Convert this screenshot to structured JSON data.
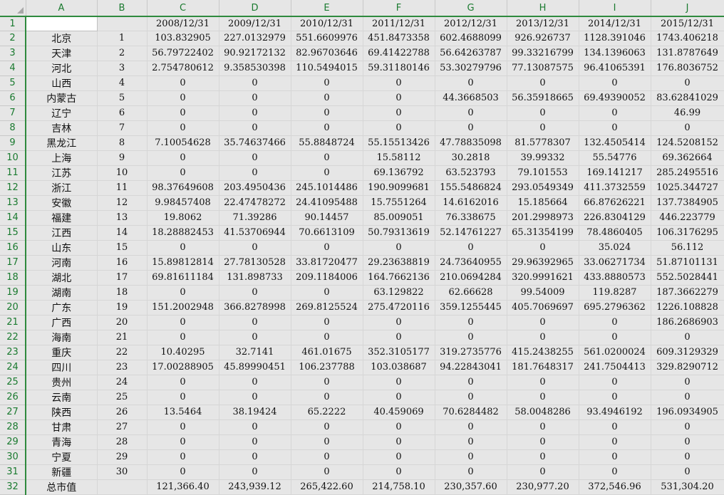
{
  "columns": [
    "A",
    "B",
    "C",
    "D",
    "E",
    "F",
    "G",
    "H",
    "I",
    "J"
  ],
  "header_row": [
    "",
    "",
    "2008/12/31",
    "2009/12/31",
    "2010/12/31",
    "2011/12/31",
    "2012/12/31",
    "2013/12/31",
    "2014/12/31",
    "2015/12/31"
  ],
  "rows": [
    [
      "北京",
      "1",
      "103.832905",
      "227.0132979",
      "551.6609976",
      "451.8473358",
      "602.4688099",
      "926.926737",
      "1128.391046",
      "1743.406218"
    ],
    [
      "天津",
      "2",
      "56.79722402",
      "90.92172132",
      "82.96703646",
      "69.41422788",
      "56.64263787",
      "99.33216799",
      "134.1396063",
      "131.8787649"
    ],
    [
      "河北",
      "3",
      "2.754780612",
      "9.358530398",
      "110.5494015",
      "59.31180146",
      "53.30279796",
      "77.13087575",
      "96.41065391",
      "176.8036752"
    ],
    [
      "山西",
      "4",
      "0",
      "0",
      "0",
      "0",
      "0",
      "0",
      "0",
      "0"
    ],
    [
      "内蒙古",
      "5",
      "0",
      "0",
      "0",
      "0",
      "44.3668503",
      "56.35918665",
      "69.49390052",
      "83.62841029"
    ],
    [
      "辽宁",
      "6",
      "0",
      "0",
      "0",
      "0",
      "0",
      "0",
      "0",
      "46.99"
    ],
    [
      "吉林",
      "7",
      "0",
      "0",
      "0",
      "0",
      "0",
      "0",
      "0",
      "0"
    ],
    [
      "黑龙江",
      "8",
      "7.10054628",
      "35.74637466",
      "55.8848724",
      "55.15513426",
      "47.78835098",
      "81.5778307",
      "132.4505414",
      "124.5208152"
    ],
    [
      "上海",
      "9",
      "0",
      "0",
      "0",
      "15.58112",
      "30.2818",
      "39.99332",
      "55.54776",
      "69.362664"
    ],
    [
      "江苏",
      "10",
      "0",
      "0",
      "0",
      "69.136792",
      "63.523793",
      "79.101553",
      "169.141217",
      "285.2495516"
    ],
    [
      "浙江",
      "11",
      "98.37649608",
      "203.4950436",
      "245.1014486",
      "190.9099681",
      "155.5486824",
      "293.0549349",
      "411.3732559",
      "1025.344727"
    ],
    [
      "安徽",
      "12",
      "9.98457408",
      "22.47478272",
      "24.41095488",
      "15.7551264",
      "14.6162016",
      "15.185664",
      "66.87626221",
      "137.7384905"
    ],
    [
      "福建",
      "13",
      "19.8062",
      "71.39286",
      "90.14457",
      "85.009051",
      "76.338675",
      "201.2998973",
      "226.8304129",
      "446.223779"
    ],
    [
      "江西",
      "14",
      "18.28882453",
      "41.53706944",
      "70.6613109",
      "50.79313619",
      "52.14761227",
      "65.31354199",
      "78.4860405",
      "106.3176295"
    ],
    [
      "山东",
      "15",
      "0",
      "0",
      "0",
      "0",
      "0",
      "0",
      "35.024",
      "56.112"
    ],
    [
      "河南",
      "16",
      "15.89812814",
      "27.78130528",
      "33.81720477",
      "29.23638819",
      "24.73640955",
      "29.96392965",
      "33.06271734",
      "51.87101131"
    ],
    [
      "湖北",
      "17",
      "69.81611184",
      "131.898733",
      "209.1184006",
      "164.7662136",
      "210.0694284",
      "320.9991621",
      "433.8880573",
      "552.5028441"
    ],
    [
      "湖南",
      "18",
      "0",
      "0",
      "0",
      "63.129822",
      "62.66628",
      "99.54009",
      "119.8287",
      "187.3662279"
    ],
    [
      "广东",
      "19",
      "151.2002948",
      "366.8278998",
      "269.8125524",
      "275.4720116",
      "359.1255445",
      "405.7069697",
      "695.2796362",
      "1226.108828"
    ],
    [
      "广西",
      "20",
      "0",
      "0",
      "0",
      "0",
      "0",
      "0",
      "0",
      "186.2686903"
    ],
    [
      "海南",
      "21",
      "0",
      "0",
      "0",
      "0",
      "0",
      "0",
      "0",
      "0"
    ],
    [
      "重庆",
      "22",
      "10.40295",
      "32.7141",
      "461.01675",
      "352.3105177",
      "319.2735776",
      "415.2438255",
      "561.0200024",
      "609.3129329"
    ],
    [
      "四川",
      "23",
      "17.00288905",
      "45.89990451",
      "106.237788",
      "103.038687",
      "94.22843041",
      "181.7648317",
      "241.7504413",
      "329.8290712"
    ],
    [
      "贵州",
      "24",
      "0",
      "0",
      "0",
      "0",
      "0",
      "0",
      "0",
      "0"
    ],
    [
      "云南",
      "25",
      "0",
      "0",
      "0",
      "0",
      "0",
      "0",
      "0",
      "0"
    ],
    [
      "陕西",
      "26",
      "13.5464",
      "38.19424",
      "65.2222",
      "40.459069",
      "70.6284482",
      "58.0048286",
      "93.4946192",
      "196.0934905"
    ],
    [
      "甘肃",
      "27",
      "0",
      "0",
      "0",
      "0",
      "0",
      "0",
      "0",
      "0"
    ],
    [
      "青海",
      "28",
      "0",
      "0",
      "0",
      "0",
      "0",
      "0",
      "0",
      "0"
    ],
    [
      "宁夏",
      "29",
      "0",
      "0",
      "0",
      "0",
      "0",
      "0",
      "0",
      "0"
    ],
    [
      "新疆",
      "30",
      "0",
      "0",
      "0",
      "0",
      "0",
      "0",
      "0",
      "0"
    ],
    [
      "总市值",
      "",
      "121,366.40",
      "243,939.12",
      "265,422.60",
      "214,758.10",
      "230,357.60",
      "230,977.20",
      "372,546.96",
      "531,304.20"
    ]
  ]
}
